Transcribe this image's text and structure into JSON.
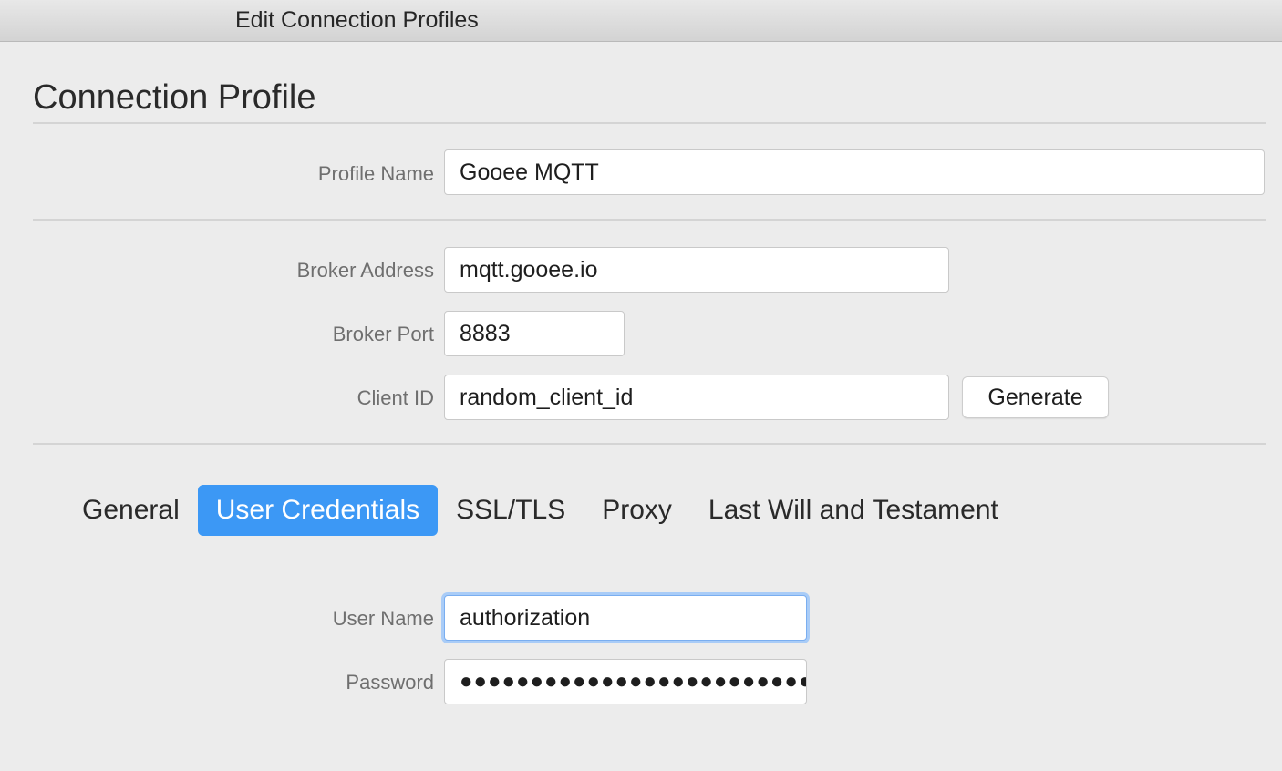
{
  "window": {
    "title": "Edit Connection Profiles"
  },
  "section": {
    "heading": "Connection Profile"
  },
  "profile": {
    "name_label": "Profile Name",
    "name_value": "Gooee MQTT"
  },
  "broker": {
    "address_label": "Broker Address",
    "address_value": "mqtt.gooee.io",
    "port_label": "Broker Port",
    "port_value": "8883",
    "client_id_label": "Client ID",
    "client_id_value": "random_client_id",
    "generate_label": "Generate"
  },
  "tabs": [
    {
      "label": "General",
      "active": false
    },
    {
      "label": "User Credentials",
      "active": true
    },
    {
      "label": "SSL/TLS",
      "active": false
    },
    {
      "label": "Proxy",
      "active": false
    },
    {
      "label": "Last Will and Testament",
      "active": false
    }
  ],
  "credentials": {
    "username_label": "User Name",
    "username_value": "authorization",
    "password_label": "Password",
    "password_value": "●●●●●●●●●●●●●●●●●●●●●●●●●"
  },
  "colors": {
    "accent": "#3c98f5",
    "focus_ring": "#a9ccf7"
  }
}
